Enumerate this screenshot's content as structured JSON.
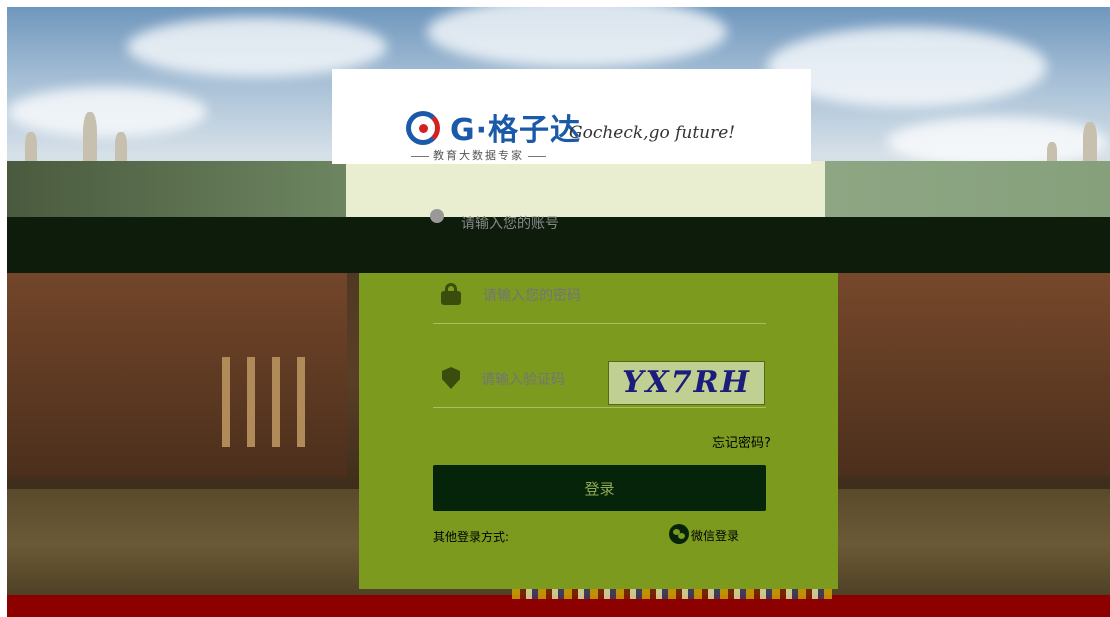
{
  "brand": {
    "logo_text": "G·格子达",
    "logo_subtitle": "教育大数据专家",
    "slogan": "Gocheck,go future!"
  },
  "login_form": {
    "username_placeholder": "请输入您的账号",
    "password_placeholder": "请输入您的密码",
    "captcha_placeholder": "请输入验证码",
    "captcha_text": "YX7RH",
    "forgot_password": "忘记密码?",
    "login_button": "登录",
    "other_login_label": "其他登录方式:",
    "wechat_login": "微信登录"
  },
  "colors": {
    "brand_blue": "#1b5aa8",
    "brand_red": "#d42020",
    "form_green": "#7b9a1e",
    "button_dark": "#06240a"
  }
}
